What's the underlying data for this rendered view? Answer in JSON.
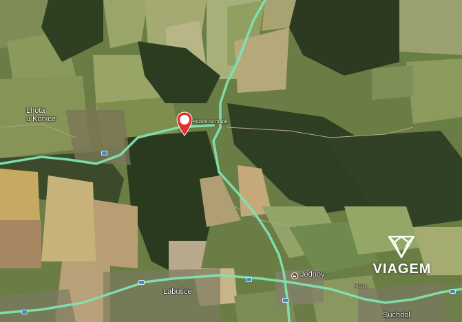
{
  "map": {
    "type": "satellite",
    "places": {
      "lhota_line1": "Lhota",
      "lhota_line2": "u Konice",
      "labutice": "Labutice",
      "jednov": "Jednov",
      "suchdol": "Suchdol",
      "klucky": "Klůčky"
    },
    "marker": {
      "label": "Pozice na mapě",
      "color": "#e0312b",
      "icon": "map-pin-icon"
    },
    "road_color": "#7fe3b2",
    "logo": {
      "text": "VIAGEM",
      "icon": "diamond-logo-icon"
    }
  }
}
